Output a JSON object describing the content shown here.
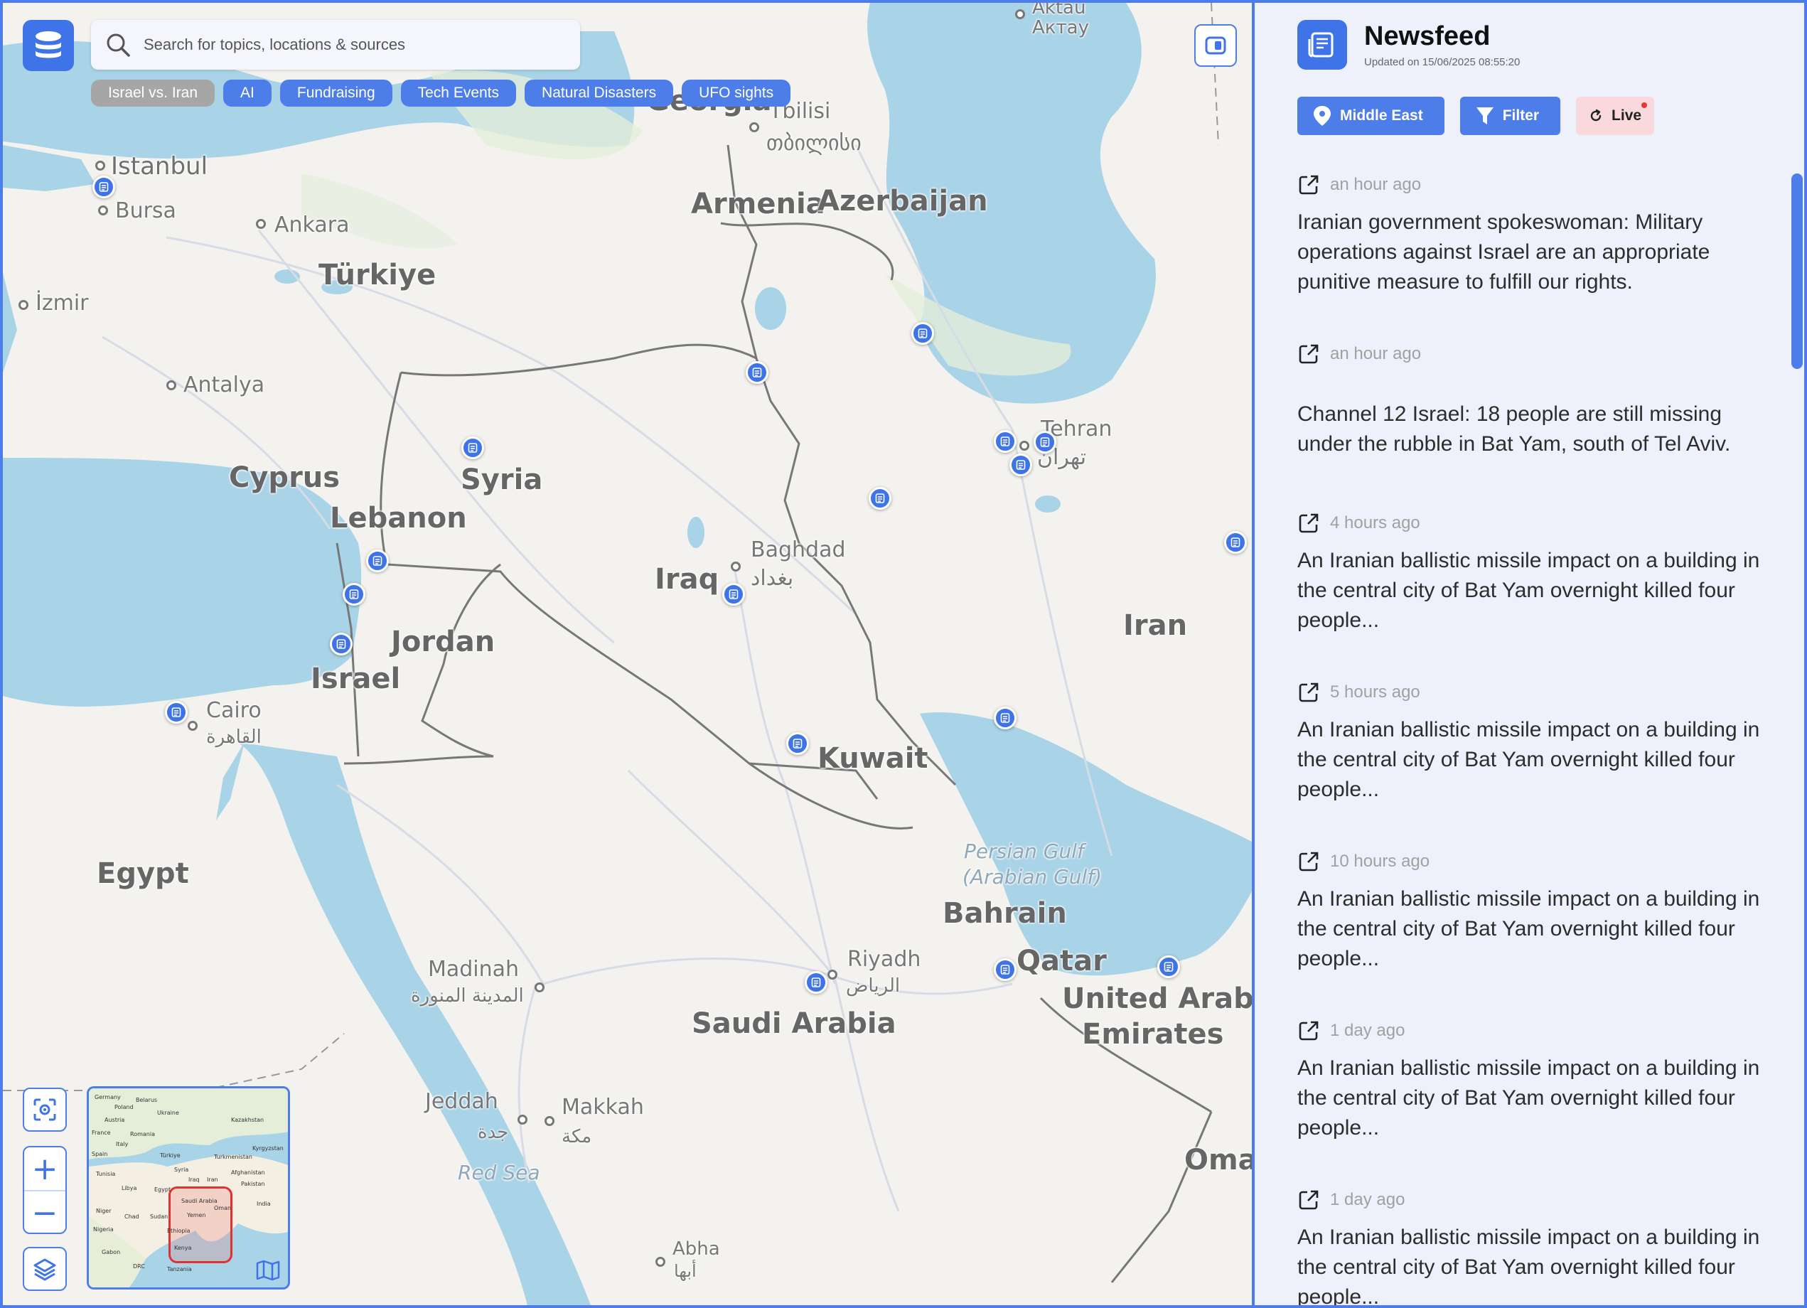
{
  "search": {
    "placeholder": "Search for topics, locations & sources"
  },
  "chips": [
    {
      "label": "Israel vs. Iran",
      "active": true
    },
    {
      "label": "AI",
      "active": false
    },
    {
      "label": "Fundraising",
      "active": false
    },
    {
      "label": "Tech Events",
      "active": false
    },
    {
      "label": "Natural Disasters",
      "active": false
    },
    {
      "label": "UFO sights",
      "active": false
    }
  ],
  "map": {
    "countries": {
      "georgia": "Georgia",
      "armenia": "Armenia",
      "azerbaijan": "Azerbaijan",
      "turkiye": "Türkiye",
      "cyprus": "Cyprus",
      "syria": "Syria",
      "lebanon": "Lebanon",
      "iraq": "Iraq",
      "jordan": "Jordan",
      "israel": "Israel",
      "iran": "Iran",
      "kuwait": "Kuwait",
      "egypt": "Egypt",
      "bahrain": "Bahrain",
      "qatar": "Qatar",
      "uae1": "United Arab",
      "uae2": "Emirates",
      "saudi": "Saudi Arabia",
      "oman": "Oman"
    },
    "cities": {
      "istanbul": "Istanbul",
      "bursa": "Bursa",
      "ankara": "Ankara",
      "izmir": "İzmir",
      "antalya": "Antalya",
      "tbilisi": "Tbilisi",
      "tbilisi_local": "თბილისი",
      "aktau": "Aktau",
      "aktau_local": "Актау",
      "tehran": "Tehran",
      "tehran_local": "تهران",
      "baghdad": "Baghdad",
      "baghdad_local": "بغداد",
      "cairo": "Cairo",
      "cairo_local": "القاهرة",
      "madinah": "Madinah",
      "madinah_local": "المدينة المنورة",
      "riyadh": "Riyadh",
      "riyadh_local": "الرياض",
      "jeddah": "Jeddah",
      "jeddah_local": "جدة",
      "makkah": "Makkah",
      "makkah_local": "مكة",
      "abha": "Abha",
      "abha_local": "أبها"
    },
    "waters": {
      "persian_gulf1": "Persian Gulf",
      "persian_gulf2": "(Arabian Gulf)",
      "red_sea": "Red Sea"
    }
  },
  "minimap": {
    "labels": [
      "Belarus",
      "Germany",
      "Poland",
      "Ukraine",
      "Kazakhstan",
      "Austria",
      "Romania",
      "France",
      "Italy",
      "Türkiye",
      "Turkmenistan",
      "Kyrgyzstan",
      "Spain",
      "Syria",
      "Iraq",
      "Afghanistan",
      "Tunisia",
      "Iran",
      "Pakistan",
      "Libya",
      "Egypt",
      "Saudi Arabia",
      "India",
      "Niger",
      "Chad",
      "Sudan",
      "Yemen",
      "Oman",
      "Nigeria",
      "Ethiopia",
      "Kenya",
      "Gabon",
      "DRC",
      "Tanzania"
    ]
  },
  "feed": {
    "title": "Newsfeed",
    "updated": "Updated on 15/06/2025 08:55:20",
    "region_button": "Middle East",
    "filter_button": "Filter",
    "live_button": "Live",
    "items": [
      {
        "time": "an hour ago",
        "text": "Iranian government spokeswoman: Military operations against Israel are an appropriate punitive measure to fulfill our rights."
      },
      {
        "time": "an hour ago",
        "text": "Channel 12 Israel: 18 people are still missing under the rubble in Bat Yam, south of Tel Aviv."
      },
      {
        "time": "4 hours ago",
        "text": "An Iranian ballistic missile impact on a building in the central city of Bat Yam overnight killed four people..."
      },
      {
        "time": "5 hours ago",
        "text": "An Iranian ballistic missile impact on a building in the central city of Bat Yam overnight killed four people..."
      },
      {
        "time": "10 hours ago",
        "text": "An Iranian ballistic missile impact on a building in the central city of Bat Yam overnight killed four people..."
      },
      {
        "time": "1 day ago",
        "text": "An Iranian ballistic missile impact on a building in the central city of Bat Yam overnight killed four people..."
      },
      {
        "time": "1 day ago",
        "text": "An Iranian ballistic missile impact on a building in the central city of Bat Yam overnight killed four people..."
      }
    ]
  },
  "colors": {
    "accent": "#4d7de8",
    "marker": "#3f73e8",
    "water": "#a9d3e6",
    "land": "#f3f2ee",
    "live_bg": "#f9d9dc"
  }
}
